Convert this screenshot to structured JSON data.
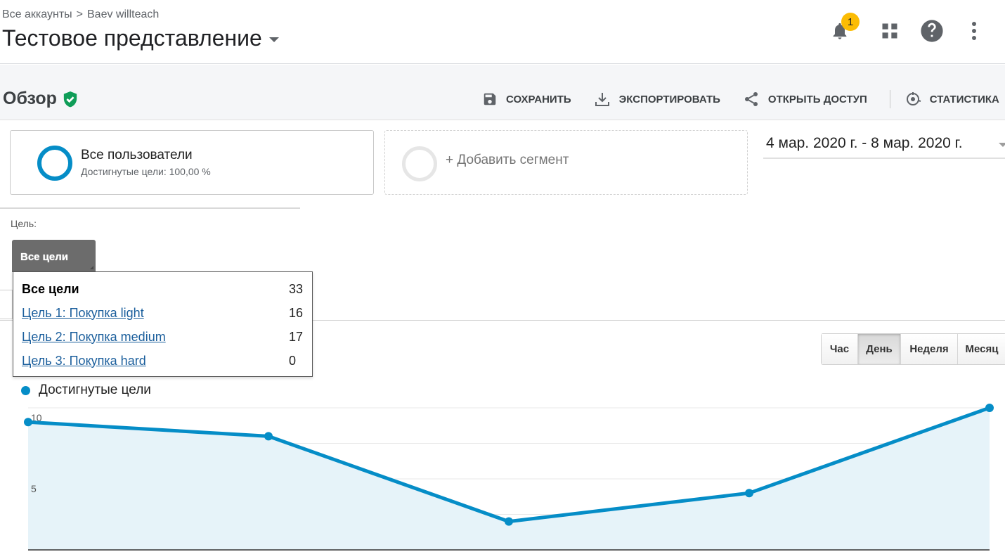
{
  "header": {
    "breadcrumb": [
      "Все аккаунты",
      "Baev willteach"
    ],
    "breadcrumb_sep": ">",
    "view_title": "Тестовое представление",
    "notification_count": "1",
    "icons": [
      "bell-icon",
      "apps-icon",
      "help-icon",
      "more-vert-icon"
    ]
  },
  "overview": {
    "title": "Обзор",
    "verified_icon": "shield-check-icon"
  },
  "toolbar": [
    {
      "label": "СОХРАНИТЬ",
      "icon": "save-icon"
    },
    {
      "label": "ЭКСПОРТИРОВАТЬ",
      "icon": "download-icon"
    },
    {
      "label": "ОТКРЫТЬ ДОСТУП",
      "icon": "share-icon"
    },
    {
      "label": "СТАТИСТИКА",
      "icon": "insights-icon"
    }
  ],
  "segments": {
    "active": {
      "name": "Все пользователи",
      "sub": "Достигнутые цели: 100,00 %"
    },
    "add_label": "+ Добавить сегмент"
  },
  "date_range": "4 мар. 2020 г. - 8 мар. 2020 г.",
  "goal": {
    "label": "Цель:",
    "tab_label": "Все цели",
    "options": [
      {
        "name": "Все цели",
        "count": "33"
      },
      {
        "name": "Цель 1: Покупка light",
        "count": "16"
      },
      {
        "name": "Цель 2: Покупка medium",
        "count": "17"
      },
      {
        "name": "Цель 3: Покупка hard",
        "count": "0"
      }
    ]
  },
  "period": {
    "options": [
      "Час",
      "День",
      "Неделя",
      "Месяц"
    ],
    "selected": "День"
  },
  "colors": {
    "accent": "#058dc7",
    "area_fill": "#e6f3f9",
    "badge": "#fbbc04",
    "verified": "#0f9d58"
  },
  "chart_data": {
    "type": "area",
    "series": [
      {
        "name": "Достигнутые цели",
        "values": [
          9.0,
          8.0,
          2.0,
          4.0,
          10.0
        ]
      }
    ],
    "ytick_labels": [
      "10",
      "5"
    ],
    "yticks": [
      10,
      5
    ],
    "ylim": [
      0,
      10
    ],
    "grid": true
  }
}
